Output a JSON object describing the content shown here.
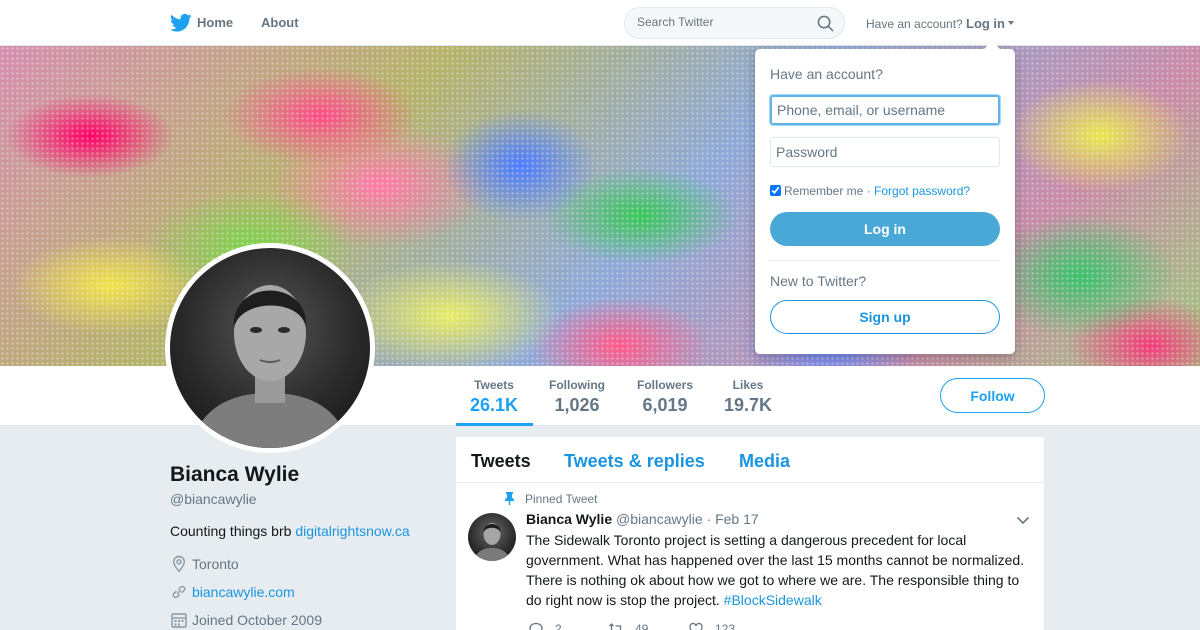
{
  "nav": {
    "logo_icon": "twitter-bird-icon",
    "home_label": "Home",
    "about_label": "About",
    "search_placeholder": "Search Twitter",
    "have_account_text": "Have an account?",
    "login_label": "Log in"
  },
  "profile": {
    "name": "Bianca Wylie",
    "handle": "@biancawylie",
    "bio_text": "Counting things brb ",
    "bio_link": "digitalrightsnow.ca",
    "location": "Toronto",
    "website": "biancawylie.com",
    "joined": "Joined October 2009"
  },
  "stats": [
    {
      "label": "Tweets",
      "value": "26.1K"
    },
    {
      "label": "Following",
      "value": "1,026"
    },
    {
      "label": "Followers",
      "value": "6,019"
    },
    {
      "label": "Likes",
      "value": "19.7K"
    }
  ],
  "follow_label": "Follow",
  "timeline": {
    "tabs": [
      "Tweets",
      "Tweets & replies",
      "Media"
    ],
    "active_tab": "Tweets"
  },
  "tweet": {
    "pinned_label": "Pinned Tweet",
    "author_name": "Bianca Wylie",
    "author_handle": "@biancawylie",
    "separator": "·",
    "date": "Feb 17",
    "text": "The Sidewalk Toronto project is setting a dangerous precedent for local government. What has happened over the last 15 months cannot be normalized. There is nothing ok about how we got to where we are. The responsible thing to do right now is stop the project. ",
    "hashtag": "#BlockSidewalk",
    "replies": "2",
    "retweets": "49",
    "likes": "123"
  },
  "login_dropdown": {
    "title": "Have an account?",
    "username_placeholder": "Phone, email, or username",
    "password_placeholder": "Password",
    "remember_label": "Remember me",
    "separator": "·",
    "forgot_label": "Forgot password?",
    "login_button": "Log in",
    "new_text": "New to Twitter?",
    "signup_button": "Sign up"
  },
  "colors": {
    "brand": "#1da1f2",
    "link": "#1b95e0",
    "login_button_bg": "#4aa8d6",
    "page_bg": "#e6ecf0"
  }
}
